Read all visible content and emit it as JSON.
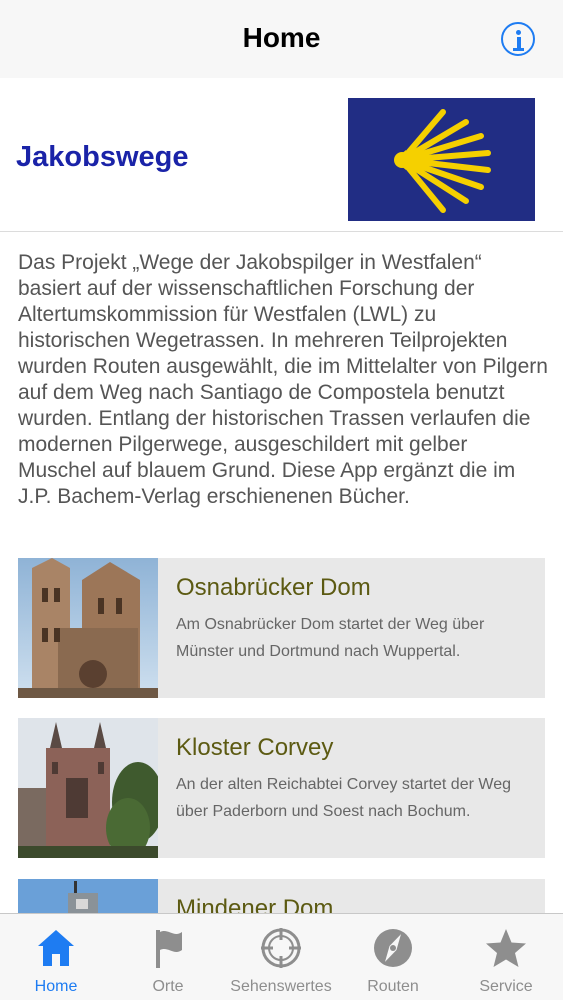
{
  "navbar": {
    "title": "Home"
  },
  "header": {
    "title": "Jakobswege"
  },
  "intro": {
    "text": "Das Projekt „Wege der Jakobspilger in Westfalen“ basiert auf der wissenschaftlichen Forschung der Altertumskommission für Westfalen (LWL) zu historischen Wegetrassen. In mehreren Teilprojekten wurden Routen ausgewählt, die im Mittelalter von Pilgern auf dem Weg nach Santiago de Compostela benutzt wurden. Entlang der historischen Trassen verlaufen die modernen Pilgerwege, ausgeschildert mit gelber Muschel auf blauem Grund. Diese App ergänzt die im J.P. Bachem-Verlag erschienenen Bücher."
  },
  "cards": [
    {
      "title": "Osnabrücker Dom",
      "description": "Am Osnabrücker Dom startet der Weg über Münster und Dortmund nach Wuppertal."
    },
    {
      "title": "Kloster Corvey",
      "description": "An der alten Reichabtei Corvey startet der Weg über Paderborn und Soest nach Bochum."
    },
    {
      "title": "Mindener Dom",
      "description": ""
    }
  ],
  "tabs": [
    {
      "label": "Home",
      "icon": "house-icon",
      "active": true
    },
    {
      "label": "Orte",
      "icon": "flag-icon",
      "active": false
    },
    {
      "label": "Sehenswertes",
      "icon": "crosshair-icon",
      "active": false
    },
    {
      "label": "Routen",
      "icon": "compass-icon",
      "active": false
    },
    {
      "label": "Service",
      "icon": "star-icon",
      "active": false
    }
  ],
  "colors": {
    "accent": "#1e7cf2",
    "header_title": "#1a23a8",
    "flag_blue": "#212d84",
    "shell_yellow": "#f5d000",
    "card_title": "#5c5a12",
    "card_bg": "#e8e8e8",
    "inactive_icon": "#8e8e8e"
  }
}
